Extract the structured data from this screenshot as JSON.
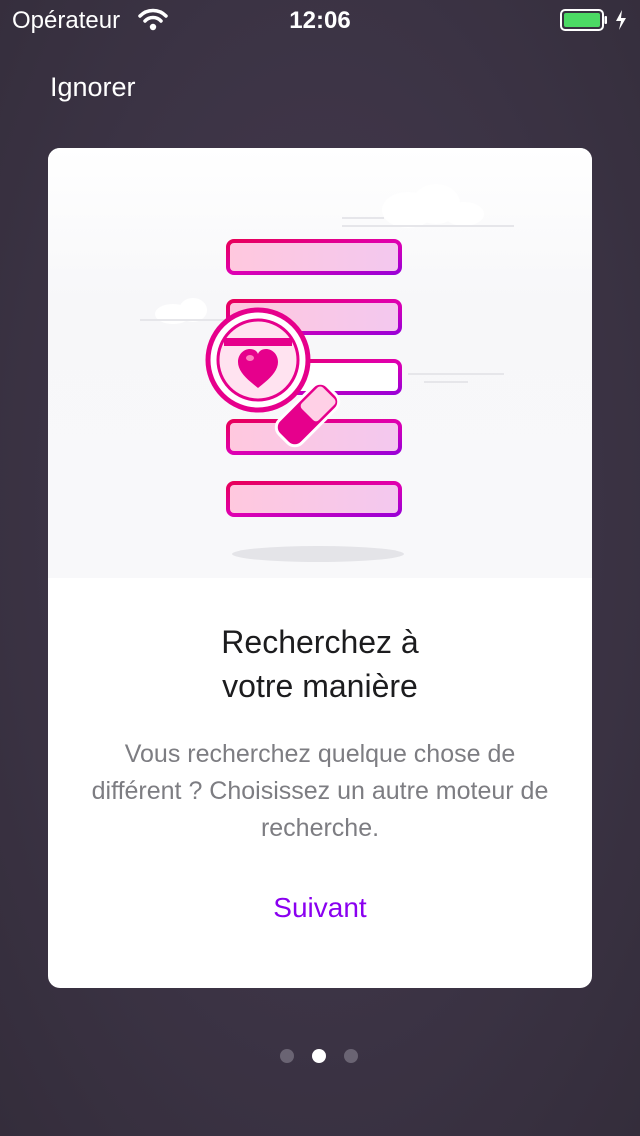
{
  "status_bar": {
    "carrier": "Opérateur",
    "time": "12:06",
    "icons": [
      "wifi-icon",
      "battery-icon",
      "charging-bolt-icon"
    ]
  },
  "onboarding": {
    "skip_label": "Ignorer",
    "card": {
      "illustration": "magnifying-glass-heart-list-illustration",
      "title_line1": "Recherchez à",
      "title_line2": "votre manière",
      "body": "Vous recherchez quelque chose de différent ? Choisissez un autre moteur de recherche.",
      "next_label": "Suivant"
    },
    "pagination": {
      "total": 3,
      "current": 2
    }
  },
  "colors": {
    "background": "#3b3344",
    "accent": "#8a00f0",
    "illustration_pink": "#e6008c",
    "battery": "#4cd964"
  }
}
